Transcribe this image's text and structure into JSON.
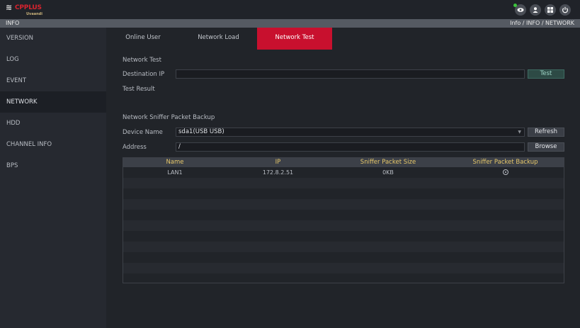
{
  "brand": {
    "mark": "≋",
    "name": "CPPLUS",
    "sub": "Uvaandi"
  },
  "top_icons": [
    "eye-icon",
    "user-icon",
    "grid-icon",
    "power-icon"
  ],
  "titlebar": {
    "title": "INFO",
    "breadcrumb": "Info  /  INFO  /  NETWORK"
  },
  "sidebar": {
    "items": [
      {
        "label": "VERSION"
      },
      {
        "label": "LOG"
      },
      {
        "label": "EVENT"
      },
      {
        "label": "NETWORK"
      },
      {
        "label": "HDD"
      },
      {
        "label": "CHANNEL INFO"
      },
      {
        "label": "BPS"
      }
    ],
    "active": "NETWORK"
  },
  "tabs": [
    {
      "label": "Online User"
    },
    {
      "label": "Network Load"
    },
    {
      "label": "Network Test"
    }
  ],
  "network_test": {
    "heading": "Network Test",
    "destination_label": "Destination IP",
    "destination_value": "",
    "test_button": "Test",
    "result_label": "Test Result"
  },
  "sniffer": {
    "heading": "Network Sniffer Packet Backup",
    "device_label": "Device Name",
    "device_value": "sda1(USB USB)",
    "refresh_button": "Refresh",
    "address_label": "Address",
    "address_value": "/",
    "browse_button": "Browse",
    "columns": [
      "Name",
      "IP",
      "Sniffer Packet Size",
      "Sniffer Packet Backup"
    ],
    "rows": [
      {
        "name": "LAN1",
        "ip": "172.8.2.51",
        "size": "0KB"
      }
    ]
  },
  "colors": {
    "accent": "#c8102e",
    "header_text": "#e6c76a"
  }
}
